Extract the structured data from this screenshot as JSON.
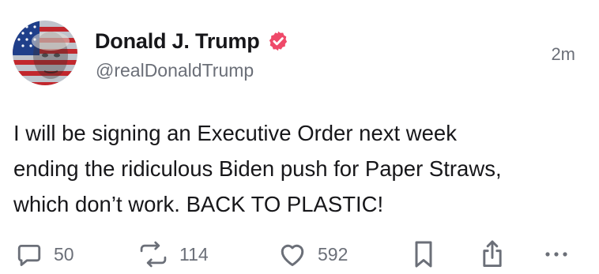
{
  "post": {
    "author": {
      "display_name": "Donald J. Trump",
      "handle": "@realDonaldTrump",
      "verified_badge_color": "#ef4969",
      "avatar_icon": "avatar-flag-portrait"
    },
    "timestamp": "2m",
    "body_lines": [
      "I will be signing an Executive Order next week",
      "ending the ridiculous Biden push for Paper Straws,",
      "which don’t work. BACK TO PLASTIC!"
    ],
    "actions": {
      "reply": {
        "icon": "speech-bubble-icon",
        "count": "50"
      },
      "repost": {
        "icon": "repost-arrows-icon",
        "count": "114"
      },
      "like": {
        "icon": "heart-icon",
        "count": "592"
      },
      "bookmark": {
        "icon": "bookmark-icon"
      },
      "share": {
        "icon": "share-icon"
      },
      "more": {
        "icon": "ellipsis-icon"
      }
    },
    "colors": {
      "text": "#17171a",
      "muted": "#6b6f78",
      "accent": "#ef4969"
    }
  }
}
